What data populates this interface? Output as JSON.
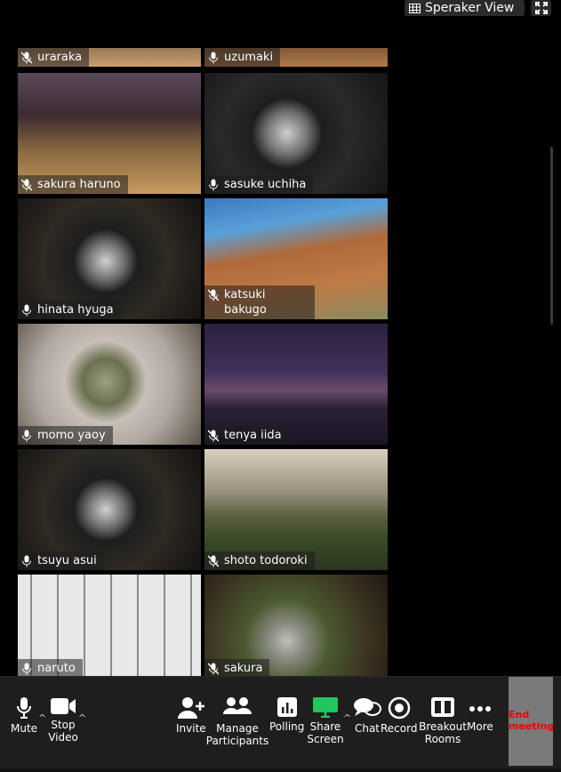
{
  "header": {
    "view_label": "Speraker View"
  },
  "participants": [
    {
      "name": "uraraka",
      "muted": true,
      "partial_top": true
    },
    {
      "name": "uzumaki",
      "muted": false,
      "partial_top": true
    },
    {
      "name": "sakura haruno",
      "muted": true
    },
    {
      "name": "sasuke uchiha",
      "muted": false
    },
    {
      "name": "hinata hyuga",
      "muted": false
    },
    {
      "name": "katsuki bakugo",
      "muted": true
    },
    {
      "name": "momo yaoy",
      "muted": false
    },
    {
      "name": "tenya iida",
      "muted": true
    },
    {
      "name": "tsuyu asui",
      "muted": false
    },
    {
      "name": "shoto todoroki",
      "muted": true
    },
    {
      "name": "naruto",
      "muted": false
    },
    {
      "name": "sakura",
      "muted": true
    }
  ],
  "toolbar": {
    "mute": "Mute",
    "stop_video": "Stop Video",
    "invite": "Invite",
    "manage_participants": "Manage Participants",
    "polling": "Polling",
    "share_screen": "Share Screen",
    "chat": "Chat",
    "record": "Record",
    "breakout_rooms": "Breakout Rooms",
    "more": "More",
    "end_meeting": "End meeting"
  },
  "colors": {
    "accent_share": "#22c55e",
    "end": "#ff0000"
  }
}
